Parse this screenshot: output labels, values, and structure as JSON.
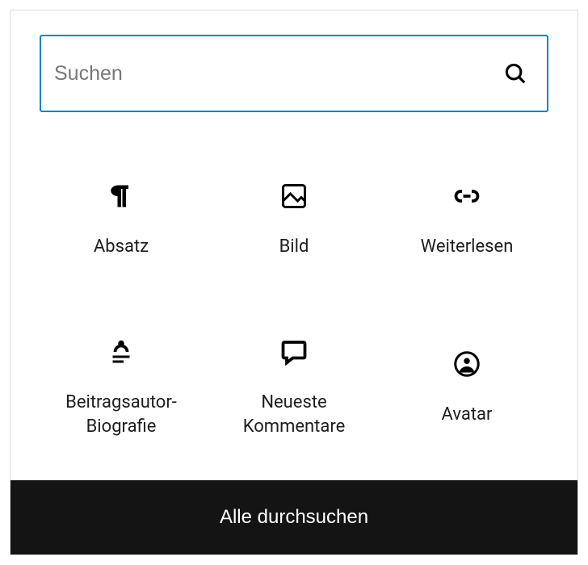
{
  "search": {
    "placeholder": "Suchen",
    "value": ""
  },
  "blocks": [
    {
      "id": "paragraph",
      "label": "Absatz",
      "icon": "paragraph-icon"
    },
    {
      "id": "image",
      "label": "Bild",
      "icon": "image-icon"
    },
    {
      "id": "readmore",
      "label": "Weiterlesen",
      "icon": "link-icon"
    },
    {
      "id": "author-bio",
      "label": "Beitragsautor-Biografie",
      "icon": "author-bio-icon"
    },
    {
      "id": "latest-comments",
      "label": "Neueste Kommentare",
      "icon": "comment-icon"
    },
    {
      "id": "avatar",
      "label": "Avatar",
      "icon": "user-circle-icon"
    }
  ],
  "footer": {
    "browse_all": "Alle durchsuchen"
  }
}
